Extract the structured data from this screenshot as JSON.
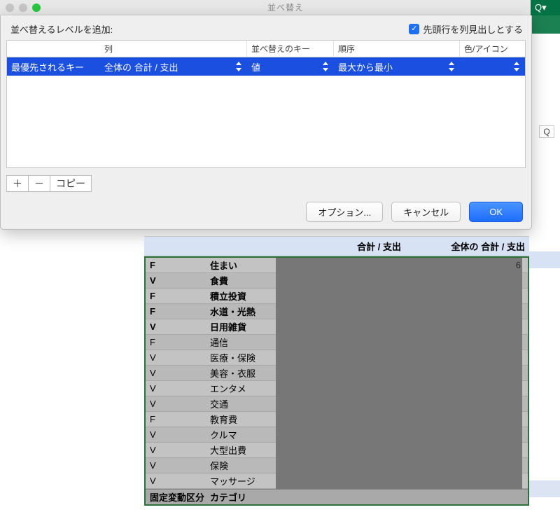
{
  "window": {
    "title": "並べ替え"
  },
  "toolbar": {
    "search_icon": "Q▾"
  },
  "dialog": {
    "add_level_label": "並べ替えるレベルを追加:",
    "header_checkbox_label": "先頭行を列見出しとする",
    "header_checkbox_checked": true,
    "columns": {
      "priority": "",
      "column": "列",
      "sort_key": "並べ替えのキー",
      "order": "順序",
      "color_icon": "色/アイコン"
    },
    "rows": [
      {
        "priority": "最優先されるキー",
        "column": "全体の 合計 / 支出",
        "sort_key": "値",
        "order": "最大から最小",
        "color_icon": ""
      }
    ],
    "buttons": {
      "plus": "＋",
      "minus": "－",
      "copy": "コピー",
      "options": "オプション...",
      "cancel": "キャンセル",
      "ok": "OK"
    }
  },
  "sheet": {
    "stray_cell": "Q",
    "headers": {
      "c": "合計 / 支出",
      "d": "全体の 合計 / 支出"
    },
    "peek_value": "6",
    "rows": [
      {
        "a": "F",
        "b": "住まい",
        "bold": true
      },
      {
        "a": "V",
        "b": "食費",
        "bold": true
      },
      {
        "a": "F",
        "b": "積立投資",
        "bold": true
      },
      {
        "a": "F",
        "b": "水道・光熱",
        "bold": true
      },
      {
        "a": "V",
        "b": "日用雑貨",
        "bold": true
      },
      {
        "a": "F",
        "b": "通信",
        "bold": false
      },
      {
        "a": "V",
        "b": "医療・保険",
        "bold": false
      },
      {
        "a": "V",
        "b": "美容・衣服",
        "bold": false
      },
      {
        "a": "V",
        "b": "エンタメ",
        "bold": false
      },
      {
        "a": "V",
        "b": "交通",
        "bold": false
      },
      {
        "a": "F",
        "b": "教育費",
        "bold": false
      },
      {
        "a": "V",
        "b": "クルマ",
        "bold": false
      },
      {
        "a": "V",
        "b": "大型出費",
        "bold": false
      },
      {
        "a": "V",
        "b": "保険",
        "bold": false
      },
      {
        "a": "V",
        "b": "マッサージ",
        "bold": false
      }
    ],
    "footer": {
      "a": "固定変動区分",
      "b": "カテゴリ"
    }
  }
}
